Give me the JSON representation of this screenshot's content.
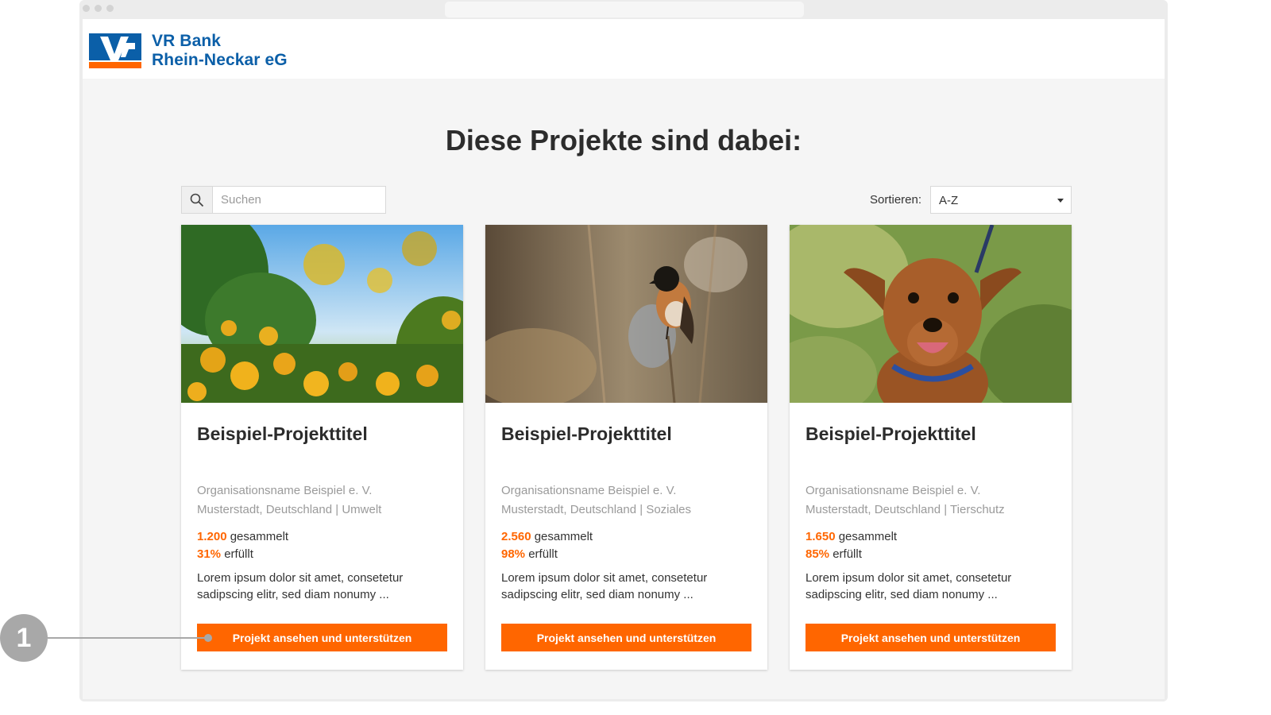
{
  "header": {
    "logo_line1": "VR Bank",
    "logo_line2": "Rhein-Neckar eG",
    "brand_blue": "#0b5fa8",
    "brand_orange": "#ff6600"
  },
  "page": {
    "title": "Diese Projekte sind dabei:"
  },
  "search": {
    "placeholder": "Suchen",
    "value": "",
    "icon": "search-icon"
  },
  "sort": {
    "label": "Sortieren:",
    "value": "A-Z"
  },
  "cards": [
    {
      "image": "flowers-photo",
      "title": "Beispiel-Projekttitel",
      "org": "Organisationsname Beispiel e. V.",
      "location": "Musterstadt, Deutschland | Umwelt",
      "amount": "1.200",
      "amount_label": "gesammelt",
      "percent": "31%",
      "percent_label": "erfüllt",
      "description": "Lorem ipsum dolor sit amet, consetetur sadipscing elitr, sed diam nonumy ...",
      "button": "Projekt ansehen und unterstützen"
    },
    {
      "image": "bird-photo",
      "title": "Beispiel-Projekttitel",
      "org": "Organisationsname Beispiel e. V.",
      "location": "Musterstadt, Deutschland | Soziales",
      "amount": "2.560",
      "amount_label": "gesammelt",
      "percent": "98%",
      "percent_label": "erfüllt",
      "description": "Lorem ipsum dolor sit amet, consetetur sadipscing elitr, sed diam nonumy ...",
      "button": "Projekt ansehen und unterstützen"
    },
    {
      "image": "dog-photo",
      "title": "Beispiel-Projekttitel",
      "org": "Organisationsname Beispiel e. V.",
      "location": "Musterstadt, Deutschland | Tierschutz",
      "amount": "1.650",
      "amount_label": "gesammelt",
      "percent": "85%",
      "percent_label": "erfüllt",
      "description": "Lorem ipsum dolor sit amet, consetetur sadipscing elitr, sed diam nonumy ...",
      "button": "Projekt ansehen und unterstützen"
    }
  ],
  "callout": {
    "number": "1"
  }
}
